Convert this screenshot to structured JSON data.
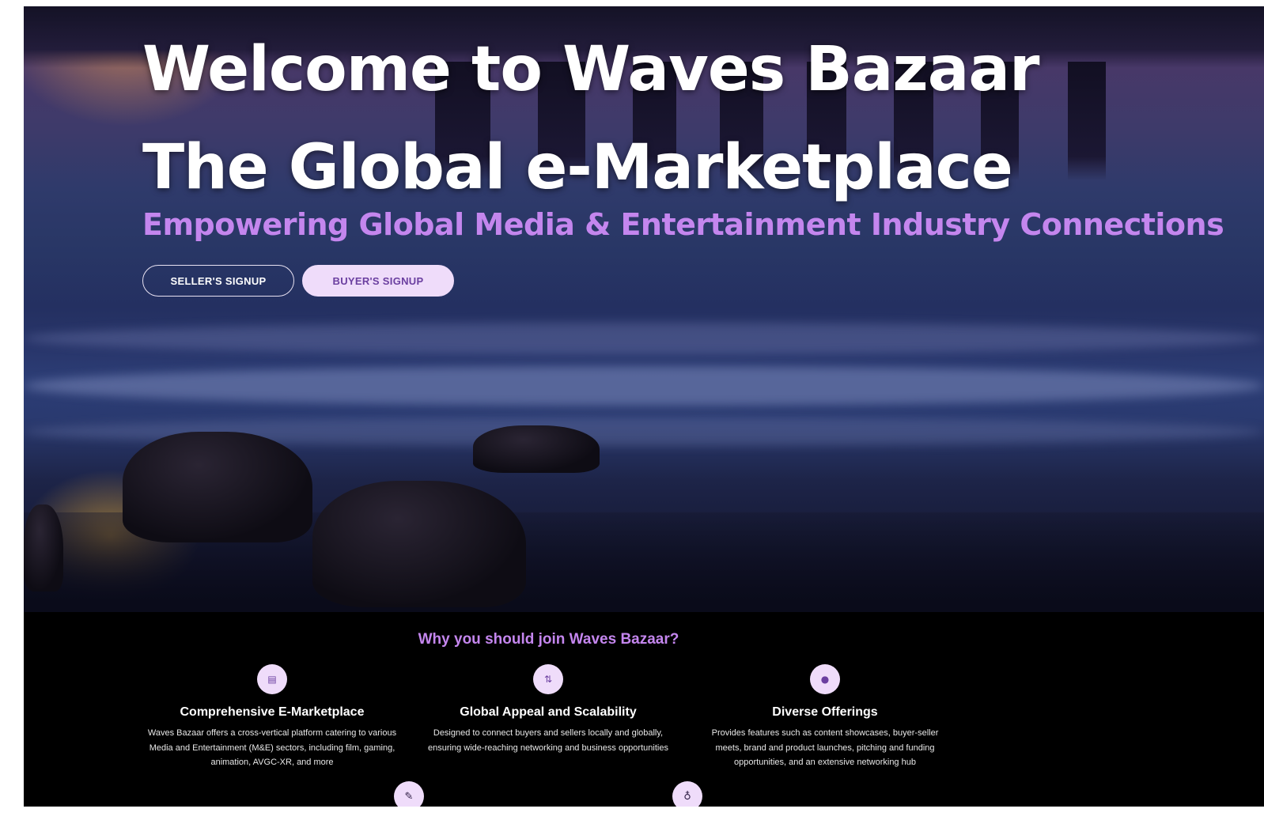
{
  "hero": {
    "title_line1": "Welcome to Waves Bazaar",
    "title_line2": "The Global e-Marketplace",
    "subtitle": "Empowering Global Media & Entertainment Industry Connections",
    "buttons": {
      "seller": "SELLER'S SIGNUP",
      "buyer": "BUYER'S SIGNUP"
    }
  },
  "why": {
    "heading": "Why you should join Waves Bazaar?",
    "features": [
      {
        "icon": "store-icon",
        "icon_glyph": "▤",
        "title": "Comprehensive E-Marketplace",
        "description": "Waves Bazaar offers a cross-vertical platform catering to various Media and Entertainment (M&E) sectors, including film, gaming, animation, AVGC-XR, and more"
      },
      {
        "icon": "sort-arrows-icon",
        "icon_glyph": "⇅",
        "title": "Global Appeal and Scalability",
        "description": "Designed to connect buyers and sellers locally and globally, ensuring wide-reaching networking and business opportunities"
      },
      {
        "icon": "globe-icon",
        "icon_glyph": "●",
        "title": "Diverse Offerings",
        "description": "Provides features such as content showcases, buyer-seller meets, brand and product launches, pitching and funding opportunities, and an extensive networking hub"
      }
    ],
    "next_icons": [
      {
        "icon": "pencil-icon",
        "icon_glyph": "✎"
      },
      {
        "icon": "lightbulb-icon",
        "icon_glyph": "♁"
      }
    ]
  },
  "colors": {
    "accent": "#c486ee",
    "button_fill": "#efdcfa",
    "button_text": "#6b3fa0",
    "section_bg": "#000000"
  }
}
